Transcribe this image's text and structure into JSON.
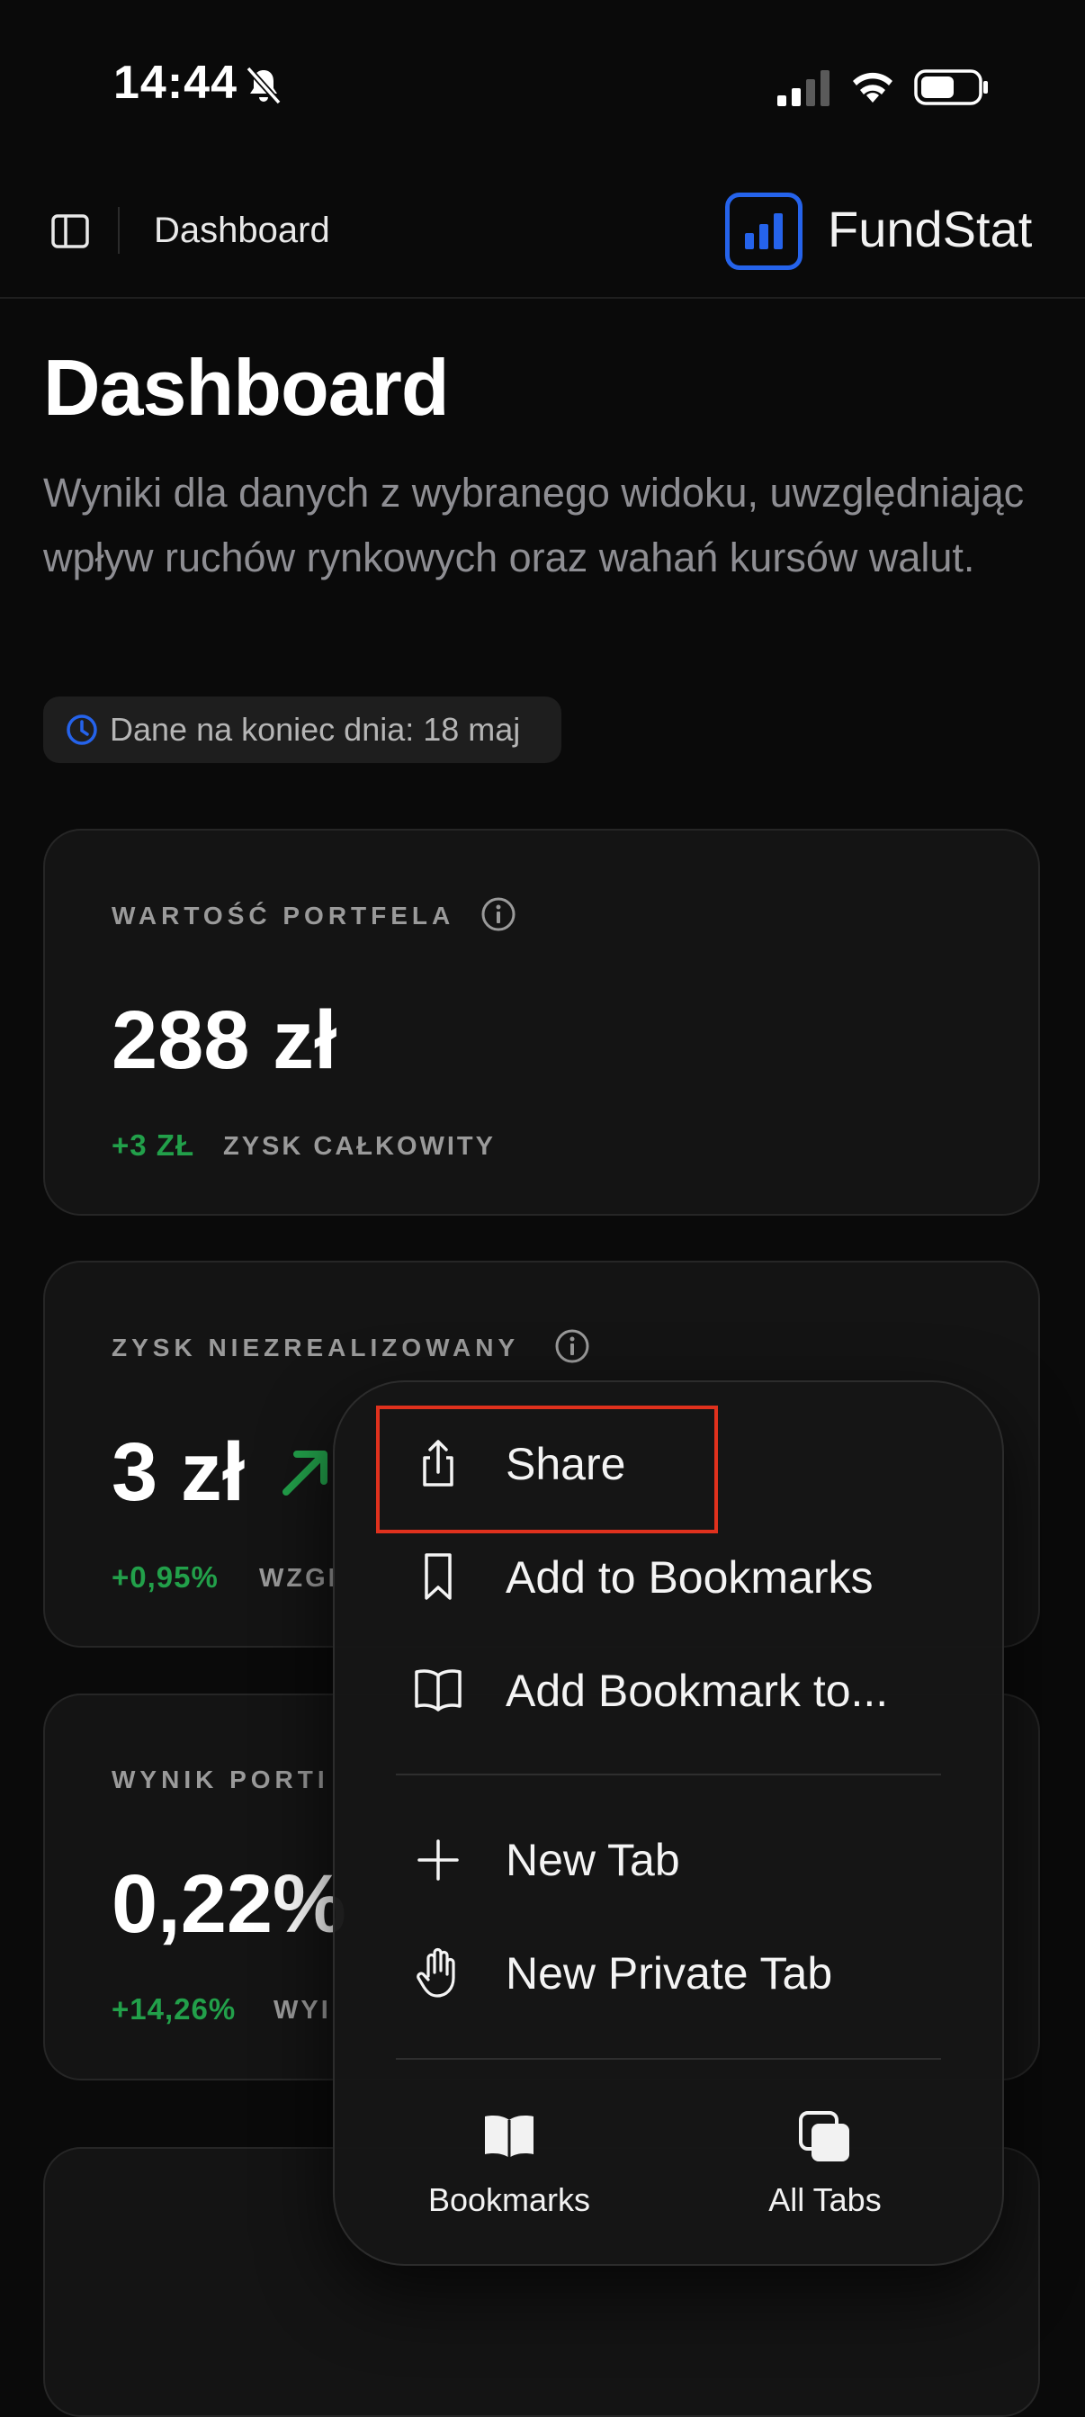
{
  "status_bar": {
    "time": "14:44"
  },
  "header": {
    "page_label": "Dashboard",
    "brand": "FundStat"
  },
  "page": {
    "title": "Dashboard",
    "description": "Wyniki dla danych z wybranego widoku, uwzględniając wpływ ruchów rynkowych oraz wahań kursów walut.",
    "date_badge": "Dane na koniec dnia: 18 maj"
  },
  "cards": {
    "portfolio_value": {
      "label": "WARTOŚĆ PORTFELA",
      "value": "288 zł",
      "gain": "+3 ZŁ",
      "gain_label": "ZYSK CAŁKOWITY"
    },
    "unrealized": {
      "label": "ZYSK NIEZREALIZOWANY",
      "value": "3 zł",
      "gain": "+0,95%",
      "gain_label": "WZGI"
    },
    "result": {
      "label": "WYNIK PORTI",
      "value": "0,22%",
      "gain": "+14,26%",
      "gain_label": "WYI"
    }
  },
  "menu": {
    "items": [
      {
        "label": "Share",
        "icon": "share-icon"
      },
      {
        "label": "Add to Bookmarks",
        "icon": "bookmark-icon"
      },
      {
        "label": "Add Bookmark to...",
        "icon": "open-book-icon"
      },
      {
        "label": "New Tab",
        "icon": "plus-icon"
      },
      {
        "label": "New Private Tab",
        "icon": "hand-icon"
      }
    ],
    "bottom": [
      {
        "label": "Bookmarks",
        "icon": "book-icon"
      },
      {
        "label": "All Tabs",
        "icon": "tabs-icon"
      }
    ]
  },
  "colors": {
    "accent": "#2563eb",
    "gain": "#22a04a",
    "highlight": "#e0311d"
  }
}
